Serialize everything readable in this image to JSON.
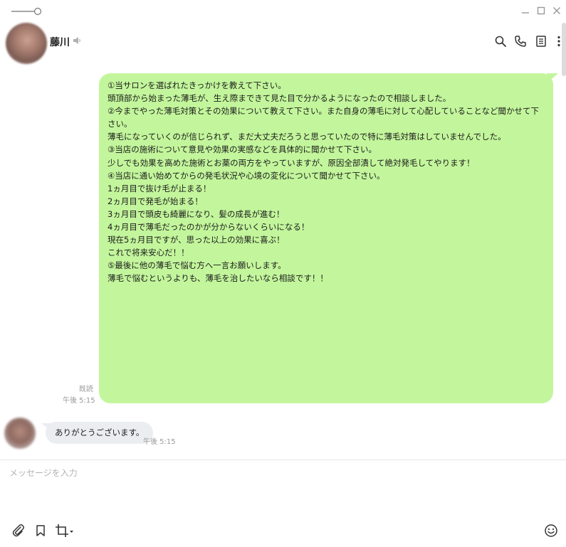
{
  "window": {
    "title_icons": [
      "pin-slider-icon",
      "minimize-icon",
      "maximize-icon",
      "close-icon"
    ]
  },
  "header": {
    "contact_name": "藤川",
    "icons": [
      "search-icon",
      "phone-icon",
      "notes-icon",
      "more-icon"
    ]
  },
  "messages": {
    "outgoing": {
      "lines": [
        "①当サロンを選ばれたきっかけを教えて下さい。",
        "",
        "頭頂部から始まった薄毛が、生え際まできて見た目で分かるようになったので相談しました。",
        "",
        "②今までやった薄毛対策とその効果について教えて下さい。また自身の薄毛に対して心配していることなど聞かせて下さい。",
        "",
        "薄毛になっていくのが信じられず、まだ大丈夫だろうと思っていたので特に薄毛対策はしていませんでした。",
        "",
        "③当店の施術について意見や効果の実感などを具体的に聞かせて下さい。",
        "",
        "少しでも効果を高めた施術とお薬の両方をやっていますが、原因全部潰して絶対発毛してやります！",
        "",
        "④当店に通い始めてからの発毛状況や心境の変化について聞かせて下さい。",
        "",
        "1ヵ月目で抜け毛が止まる！",
        "2ヵ月目で発毛が始まる！",
        "3ヵ月目で頭皮も綺麗になり、髪の成長が進む！",
        "4ヵ月目で薄毛だったのかが分からないくらいになる！",
        "現在5ヵ月目ですが、思った以上の効果に喜ぶ！",
        "",
        "これで将来安心だ！！",
        "",
        "⑤最後に他の薄毛で悩む方へ一言お願いします。",
        "",
        "薄毛で悩むというよりも、薄毛を治したいなら相談です！！"
      ],
      "read_status": "既読",
      "time": "午後 5:15"
    },
    "incoming": {
      "text": "ありがとうございます。",
      "time": "午後 5:15"
    }
  },
  "composer": {
    "placeholder": "メッセージを入力",
    "icons": [
      "attach-icon",
      "bookmark-icon",
      "crop-icon",
      "emoji-icon"
    ]
  },
  "colors": {
    "outgoing_bubble": "#c3f69c",
    "incoming_bubble": "#ebedf0",
    "muted_text": "#9a9a9a"
  }
}
